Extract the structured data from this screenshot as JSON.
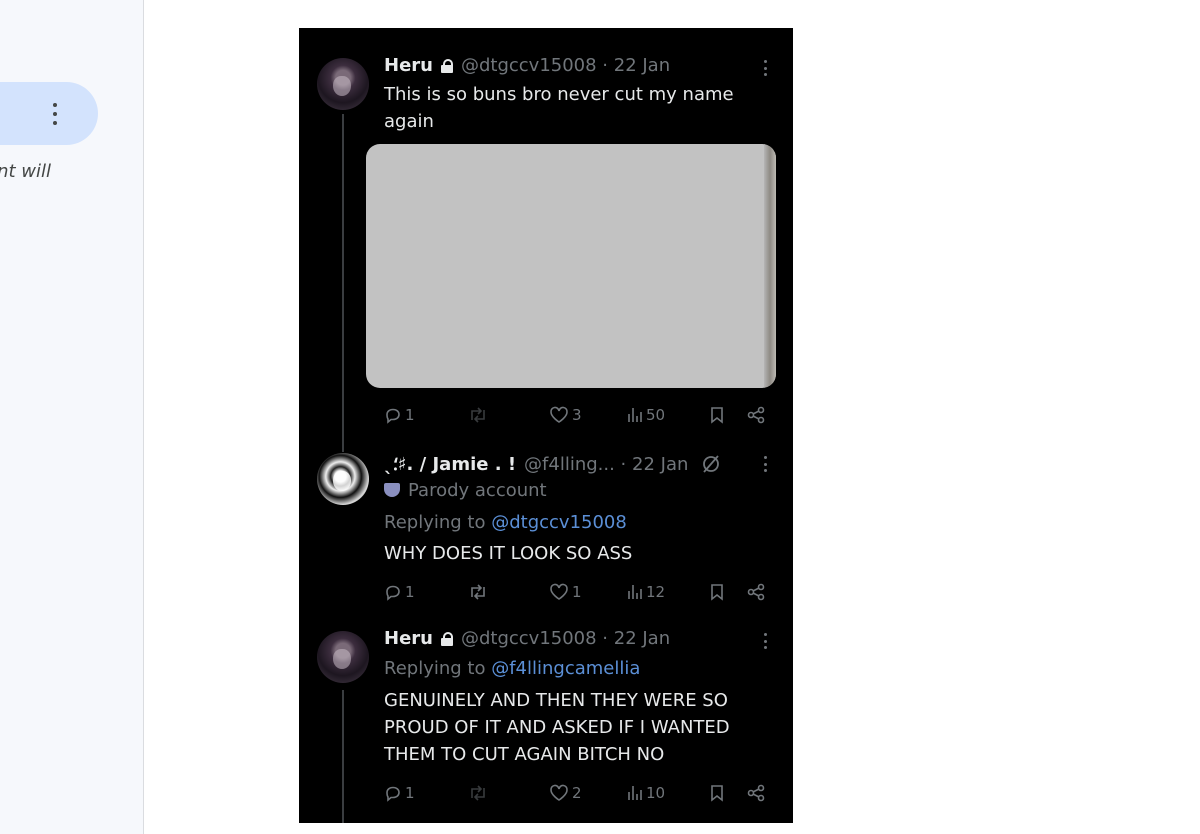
{
  "sidebar": {
    "snippet_text": "ent will"
  },
  "tweets": [
    {
      "name": "Heru",
      "handle": "@dtgccv15008 · 22 Jan",
      "text": "This is so buns bro never cut my name again",
      "counts": {
        "replies": "1",
        "reposts": "",
        "likes": "3",
        "views": "50"
      }
    },
    {
      "name": "ˎ⸵♯. / Jamie . !",
      "handle": "@f4lling... · 22 Jan",
      "parody": "Parody account",
      "replying_prefix": "Replying to",
      "replying_to": "@dtgccv15008",
      "text": "WHY DOES IT LOOK SO ASS",
      "counts": {
        "replies": "1",
        "reposts": "",
        "likes": "1",
        "views": "12"
      }
    },
    {
      "name": "Heru",
      "handle": "@dtgccv15008 · 22 Jan",
      "replying_prefix": "Replying to",
      "replying_to": "@f4llingcamellia",
      "text": "GENUINELY AND THEN THEY WERE SO PROUD OF IT AND ASKED IF I WANTED THEM TO CUT AGAIN BITCH NO",
      "counts": {
        "replies": "1",
        "reposts": "",
        "likes": "2",
        "views": "10"
      }
    }
  ],
  "icons": {
    "reply": "reply-icon",
    "repost": "repost-icon",
    "like": "heart-icon",
    "views": "views-icon",
    "bookmark": "bookmark-icon",
    "share": "share-icon",
    "lock": "lock-icon",
    "more": "more-icon"
  },
  "colors": {
    "background": "#000000",
    "text": "#e7e9ea",
    "muted": "#71767b",
    "link": "#5b8fd6",
    "sidebar": "#f6f8fc",
    "sidebar_pill": "#d3e3fd"
  }
}
